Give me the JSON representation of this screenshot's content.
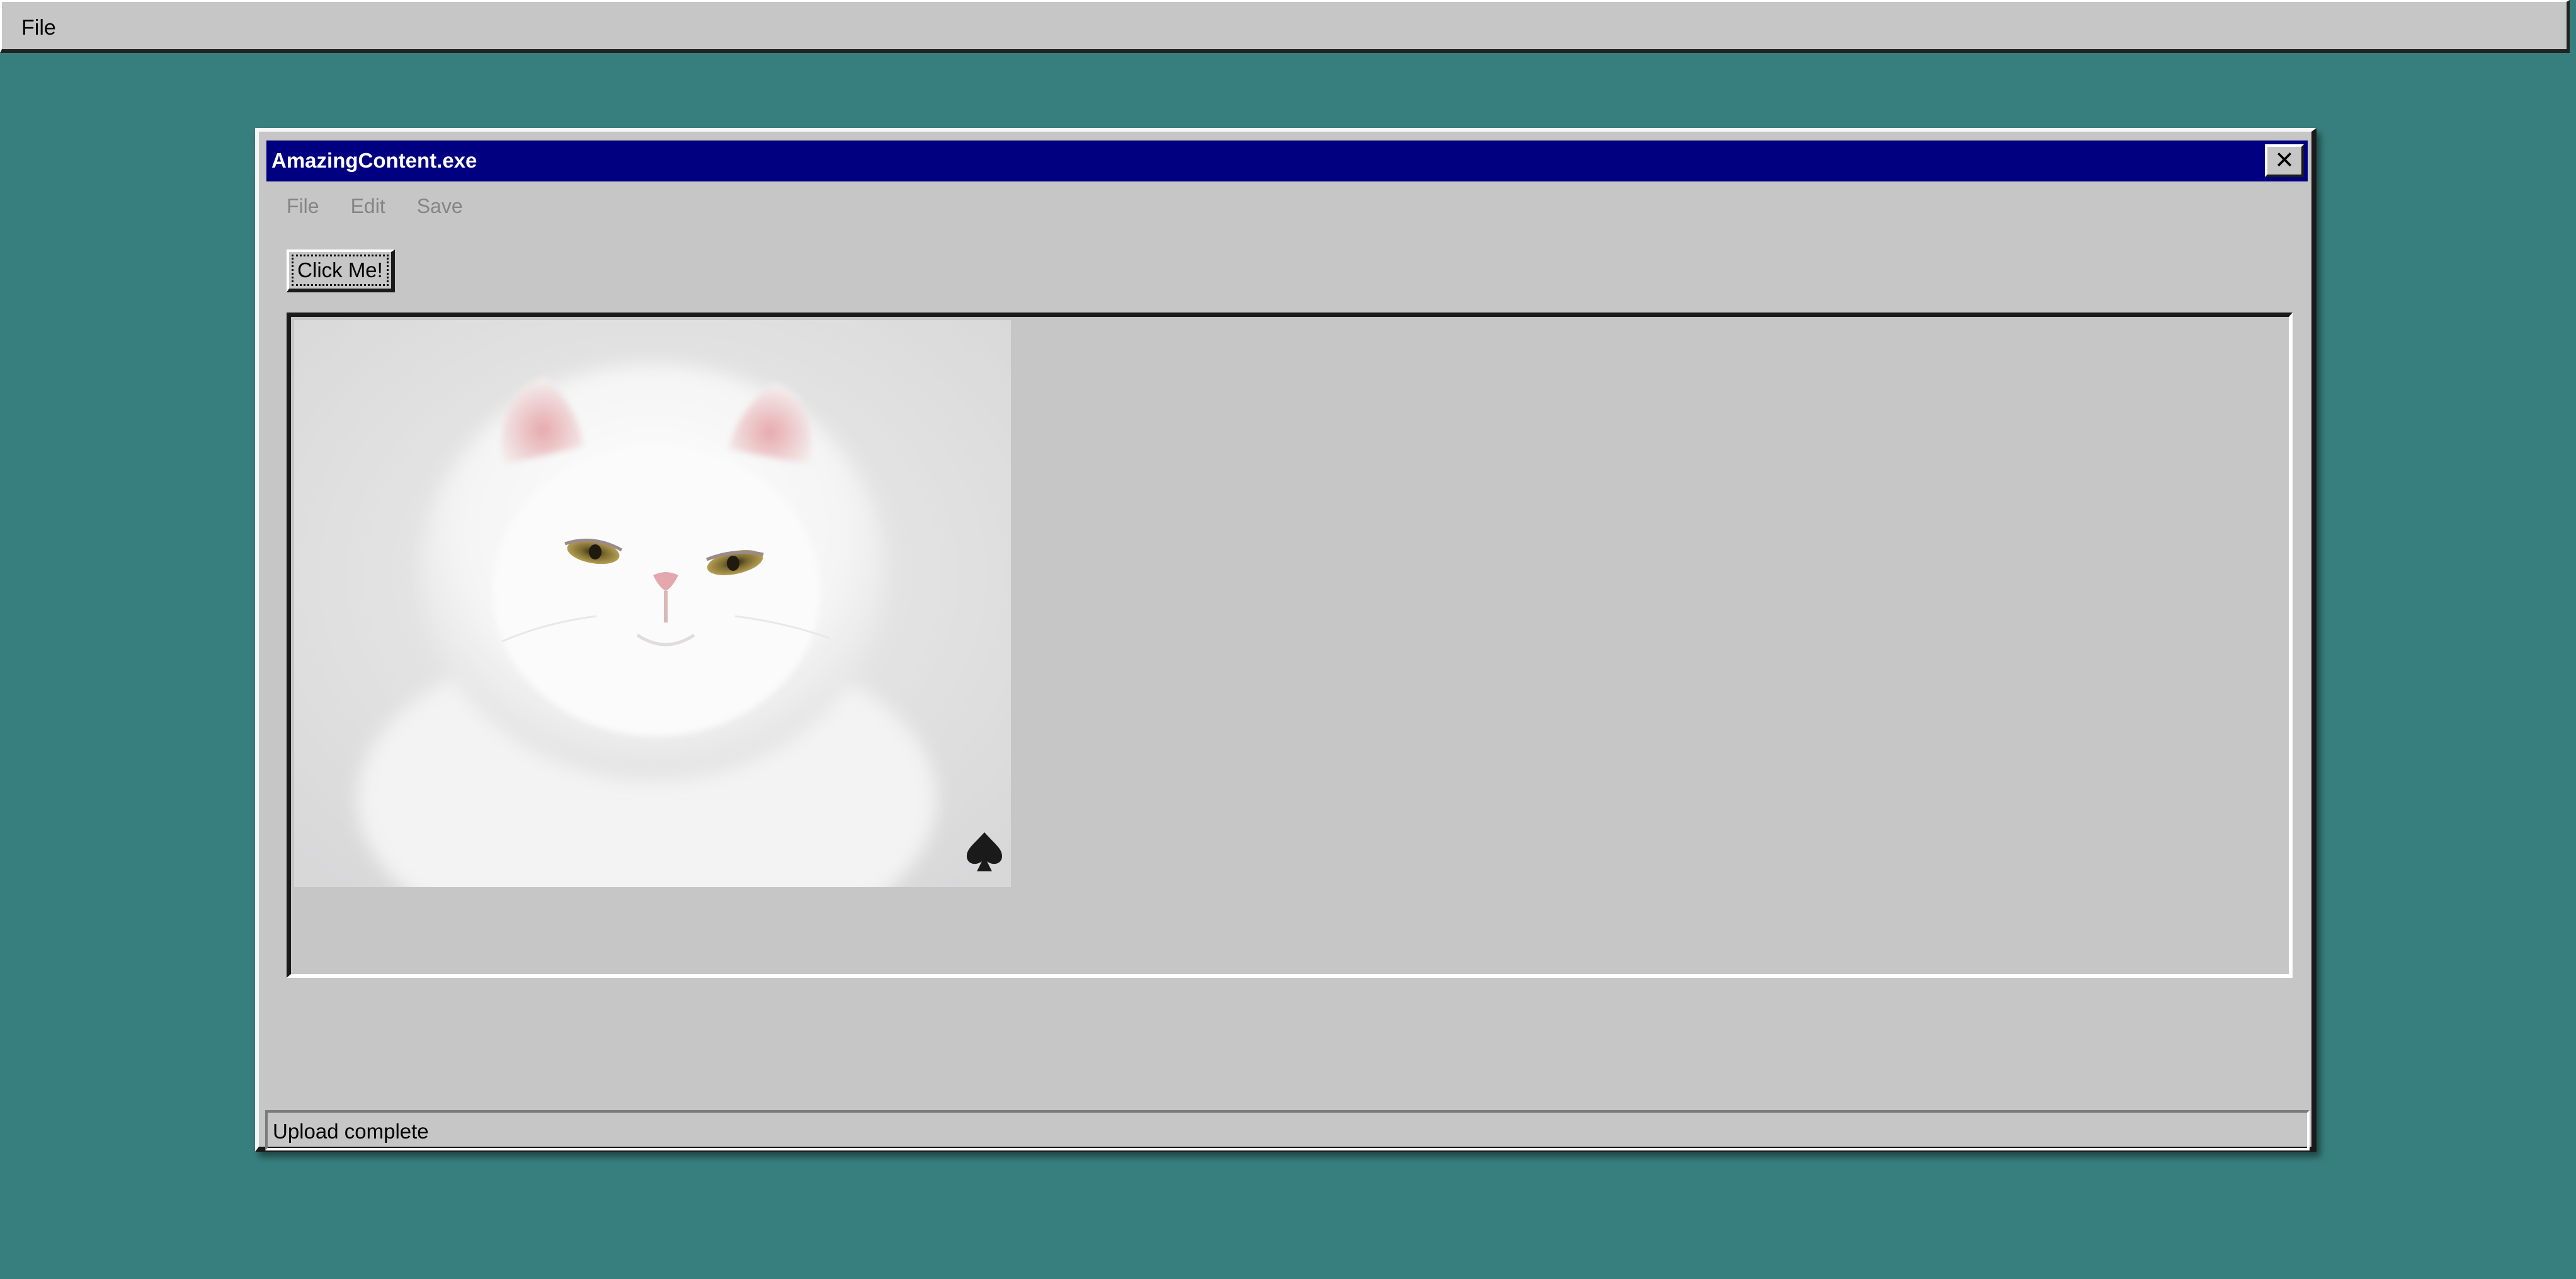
{
  "desktop": {
    "background_color": "#377f7e",
    "topbar": {
      "menu": [
        "File"
      ]
    }
  },
  "window": {
    "title": "AmazingContent.exe",
    "titlebar_color": "#000080",
    "close_glyph": "✕",
    "menu": {
      "file": "File",
      "edit": "Edit",
      "save": "Save"
    },
    "button_label": "Click Me!",
    "content": {
      "image": {
        "subject": "white persian cat",
        "badge_icon": "spade-icon"
      }
    },
    "status": "Upload complete"
  }
}
